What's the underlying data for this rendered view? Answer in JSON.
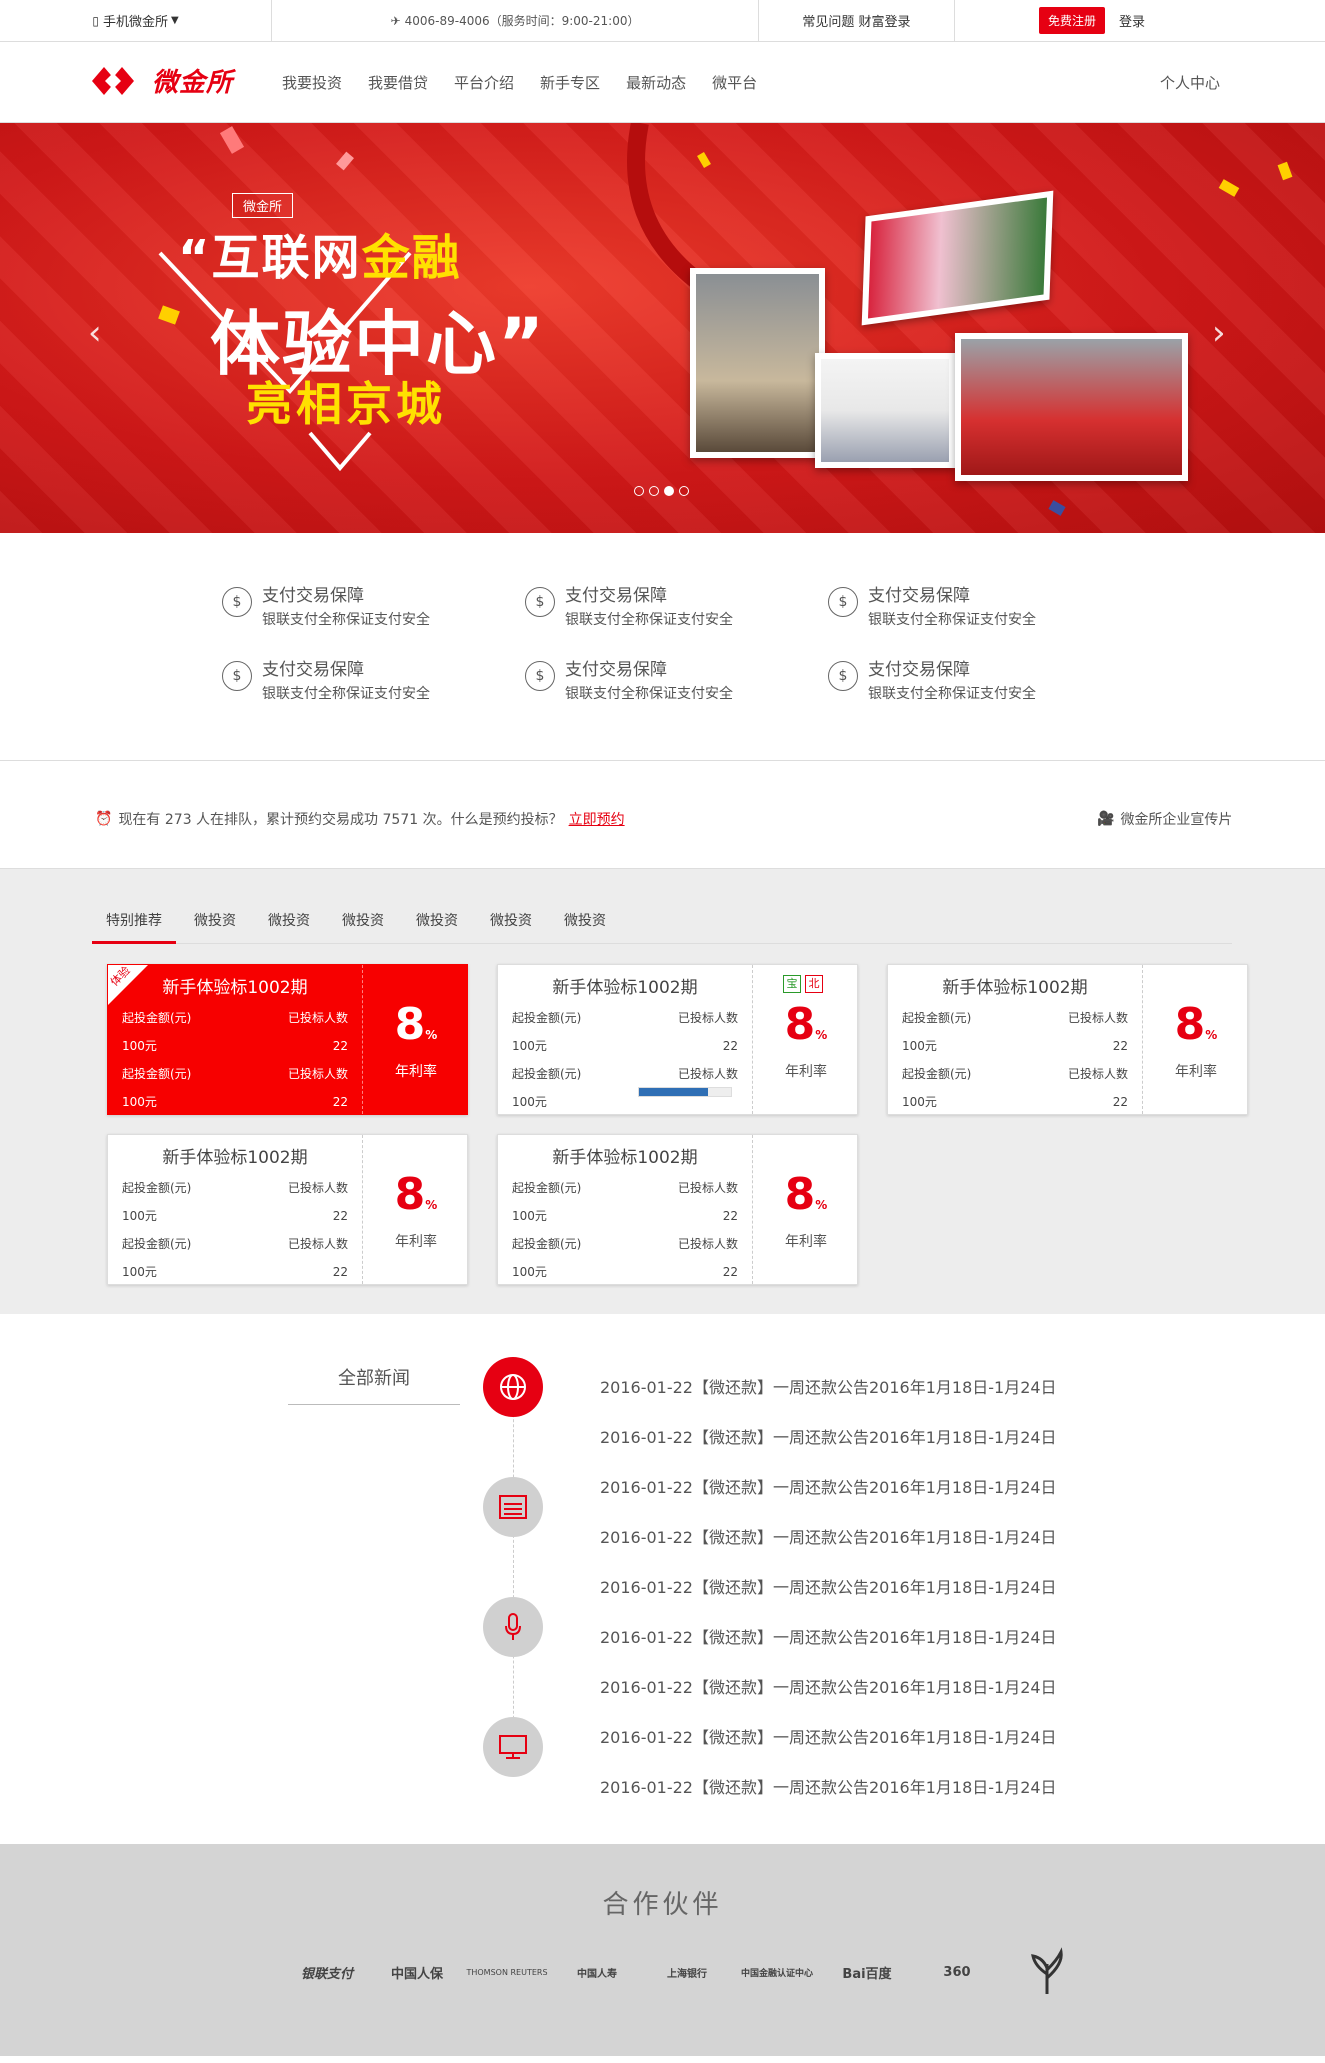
{
  "topbar": {
    "mobile": "手机微金所",
    "phone": "4006-89-4006（服务时间：9:00-21:00）",
    "help": "常见问题 财富登录",
    "register": "免费注册",
    "login": "登录"
  },
  "nav": {
    "logo": "微金所",
    "items": [
      "我要投资",
      "我要借贷",
      "平台介绍",
      "新手专区",
      "最新动态",
      "微平台"
    ],
    "personal": "个人中心"
  },
  "banner": {
    "badge": "微金所",
    "line1_a": "“互联网",
    "line1_b": "金融",
    "line2": "体验中心”",
    "line3": "亮相京城",
    "prev": "‹",
    "next": "›"
  },
  "features": [
    {
      "title": "支付交易保障",
      "sub": "银联支付全称保证支付安全"
    },
    {
      "title": "支付交易保障",
      "sub": "银联支付全称保证支付安全"
    },
    {
      "title": "支付交易保障",
      "sub": "银联支付全称保证支付安全"
    },
    {
      "title": "支付交易保障",
      "sub": "银联支付全称保证支付安全"
    },
    {
      "title": "支付交易保障",
      "sub": "银联支付全称保证支付安全"
    },
    {
      "title": "支付交易保障",
      "sub": "银联支付全称保证支付安全"
    }
  ],
  "queue": {
    "text": "现在有 273 人在排队，累计预约交易成功 7571 次。什么是预约投标？",
    "link": "立即预约",
    "right": "微金所企业宣传片"
  },
  "tabs": [
    "特别推荐",
    "微投资",
    "微投资",
    "微投资",
    "微投资",
    "微投资",
    "微投资"
  ],
  "cards": [
    {
      "title": "新手体验标1002期",
      "l1": "起投金额(元)",
      "r1": "已投标人数",
      "l2": "100元",
      "r2": "22",
      "l3": "起投金额(元)",
      "r3": "已投标人数",
      "l4": "100元",
      "r4": "22",
      "rate": "8",
      "unit": "%",
      "rate_label": "年利率",
      "ribbon": "体验"
    },
    {
      "title": "新手体验标1002期",
      "l1": "起投金额(元)",
      "r1": "已投标人数",
      "l2": "100元",
      "r2": "22",
      "l3": "起投金额(元)",
      "r3": "已投标人数",
      "l4": "100元",
      "r4": "",
      "rate": "8",
      "unit": "%",
      "rate_label": "年利率",
      "tag1": "宝",
      "tag2": "北",
      "progress": 0.75
    },
    {
      "title": "新手体验标1002期",
      "l1": "起投金额(元)",
      "r1": "已投标人数",
      "l2": "100元",
      "r2": "22",
      "l3": "起投金额(元)",
      "r3": "已投标人数",
      "l4": "100元",
      "r4": "22",
      "rate": "8",
      "unit": "%",
      "rate_label": "年利率"
    },
    {
      "title": "新手体验标1002期",
      "l1": "起投金额(元)",
      "r1": "已投标人数",
      "l2": "100元",
      "r2": "22",
      "l3": "起投金额(元)",
      "r3": "已投标人数",
      "l4": "100元",
      "r4": "22",
      "rate": "8",
      "unit": "%",
      "rate_label": "年利率"
    },
    {
      "title": "新手体验标1002期",
      "l1": "起投金额(元)",
      "r1": "已投标人数",
      "l2": "100元",
      "r2": "22",
      "l3": "起投金额(元)",
      "r3": "已投标人数",
      "l4": "100元",
      "r4": "22",
      "rate": "8",
      "unit": "%",
      "rate_label": "年利率"
    }
  ],
  "news": {
    "category": "全部新闻",
    "items": [
      "2016-01-22【微还款】一周还款公告2016年1月18日-1月24日",
      "2016-01-22【微还款】一周还款公告2016年1月18日-1月24日",
      "2016-01-22【微还款】一周还款公告2016年1月18日-1月24日",
      "2016-01-22【微还款】一周还款公告2016年1月18日-1月24日",
      "2016-01-22【微还款】一周还款公告2016年1月18日-1月24日",
      "2016-01-22【微还款】一周还款公告2016年1月18日-1月24日",
      "2016-01-22【微还款】一周还款公告2016年1月18日-1月24日",
      "2016-01-22【微还款】一周还款公告2016年1月18日-1月24日",
      "2016-01-22【微还款】一周还款公告2016年1月18日-1月24日"
    ]
  },
  "partners": {
    "title": "合作伙伴",
    "logos": [
      "银联支付",
      "中国人保",
      "THOMSON REUTERS",
      "中国人寿",
      "上海银行",
      "中国金融认证中心",
      "Bai百度",
      "360",
      ""
    ]
  }
}
